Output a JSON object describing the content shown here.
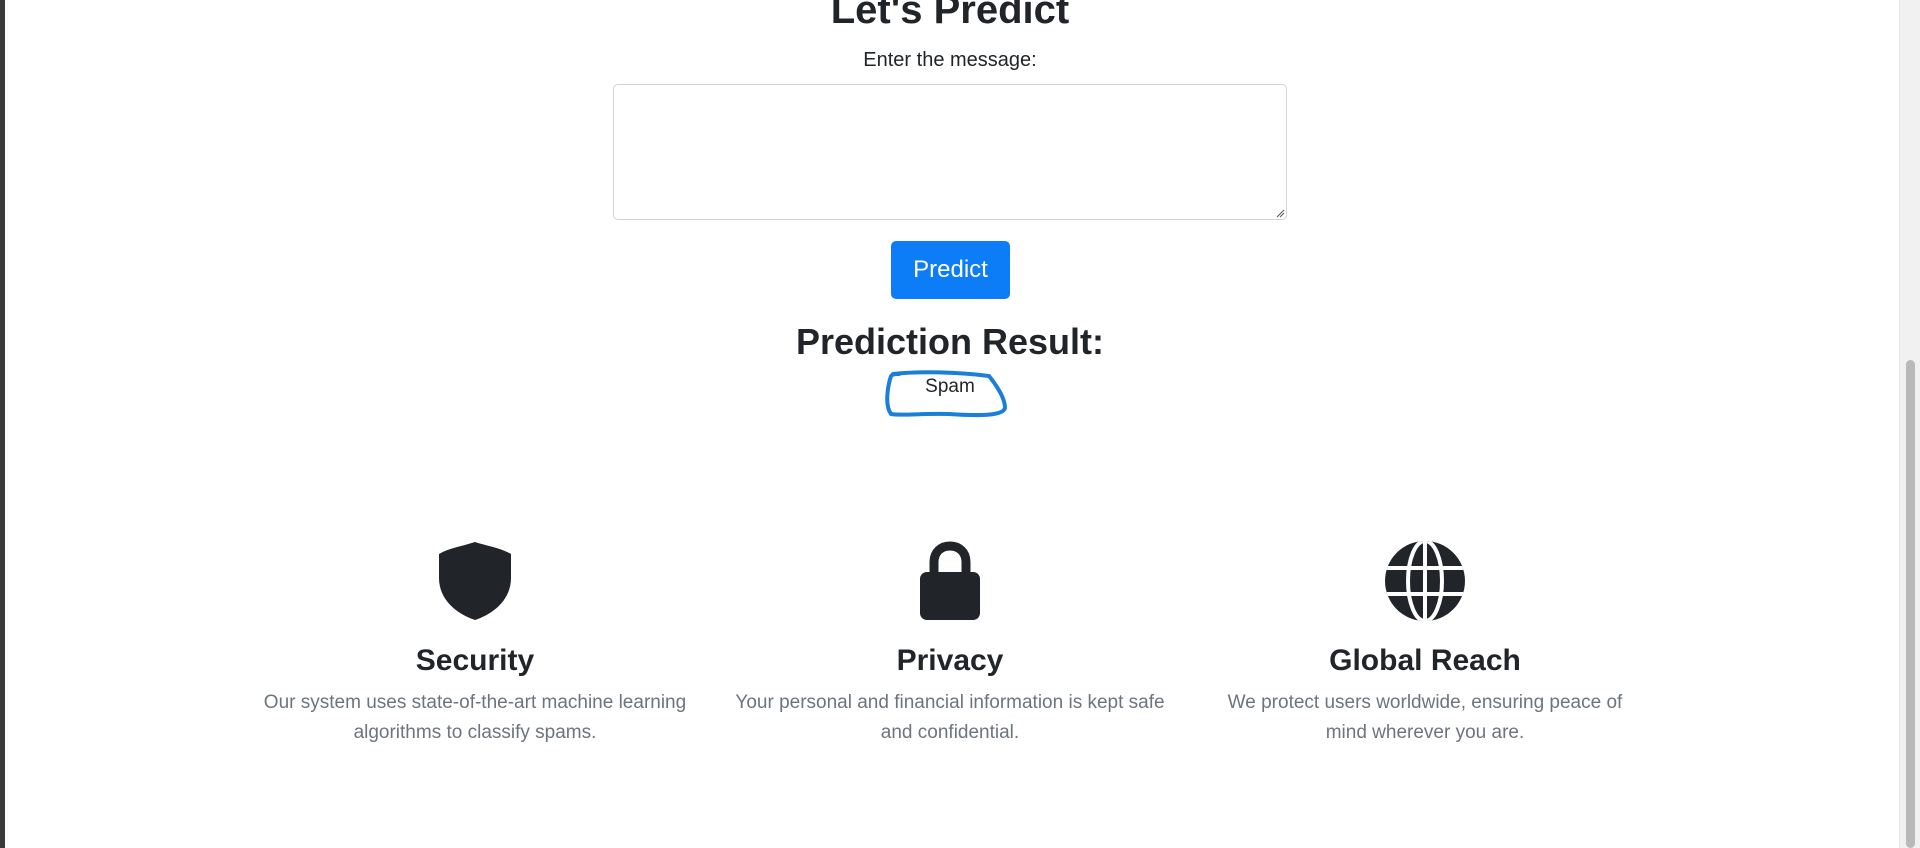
{
  "form": {
    "heading": "Let's Predict",
    "label": "Enter the message:",
    "message_value": "",
    "submit_label": "Predict"
  },
  "result": {
    "heading": "Prediction Result:",
    "value": "Spam",
    "annotation_color": "#1a7fd6"
  },
  "features": [
    {
      "icon": "shield-icon",
      "title": "Security",
      "description": "Our system uses state-of-the-art machine learning algorithms to classify spams."
    },
    {
      "icon": "lock-icon",
      "title": "Privacy",
      "description": "Your personal and financial information is kept safe and confidential."
    },
    {
      "icon": "globe-icon",
      "title": "Global Reach",
      "description": "We protect users worldwide, ensuring peace of mind wherever you are."
    }
  ],
  "colors": {
    "primary": "#0d7cf7",
    "text": "#212529",
    "muted": "#6c757d"
  }
}
